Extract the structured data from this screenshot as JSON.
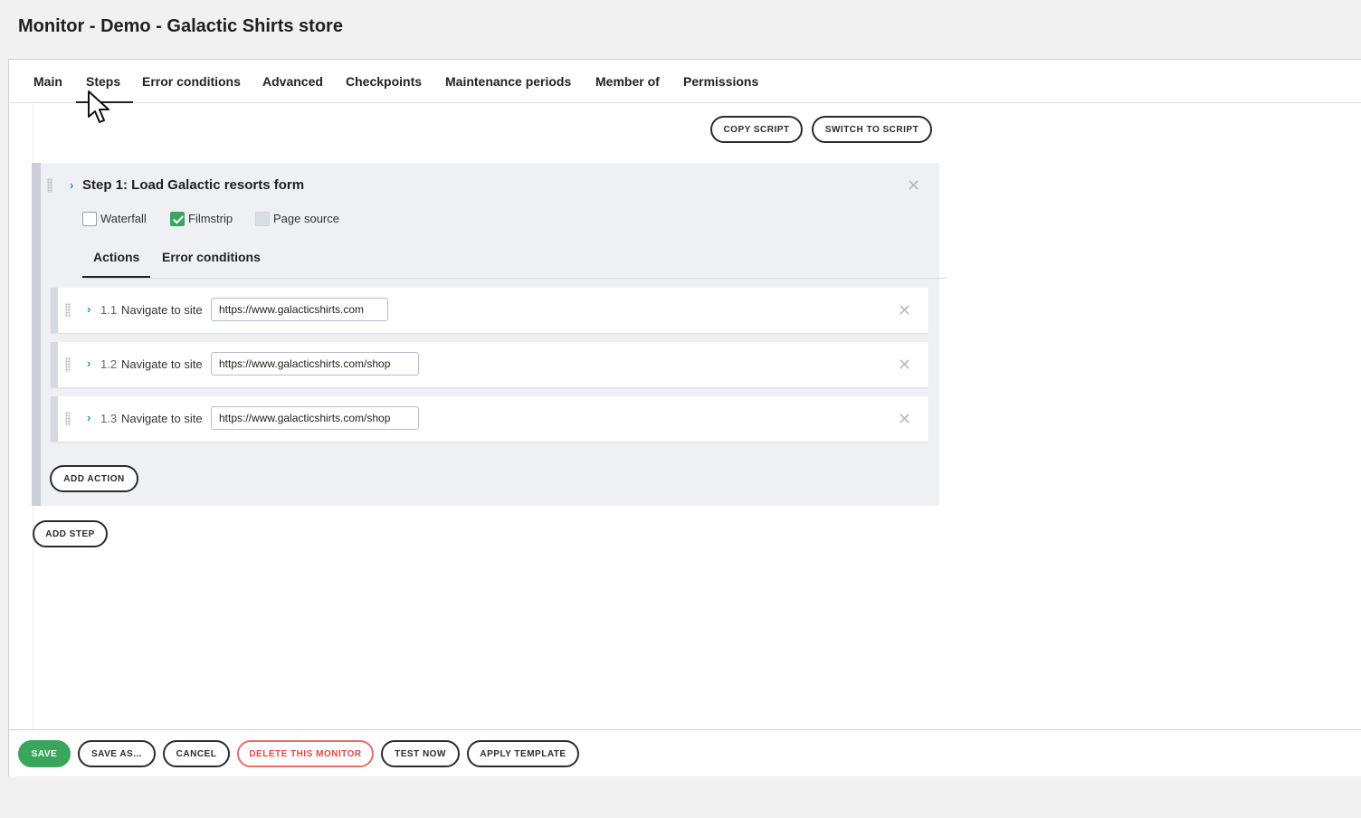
{
  "page": {
    "title": "Monitor - Demo - Galactic Shirts store"
  },
  "tabs": [
    {
      "label": "Main"
    },
    {
      "label": "Steps"
    },
    {
      "label": "Error conditions"
    },
    {
      "label": "Advanced"
    },
    {
      "label": "Checkpoints"
    },
    {
      "label": "Maintenance periods"
    },
    {
      "label": "Member of"
    },
    {
      "label": "Permissions"
    }
  ],
  "active_tab": "Steps",
  "toolbar": {
    "copy_script": "COPY SCRIPT",
    "switch_to_script": "SWITCH TO SCRIPT"
  },
  "step": {
    "title": "Step 1: Load Galactic resorts form",
    "options": [
      {
        "label": "Waterfall",
        "checked": false
      },
      {
        "label": "Filmstrip",
        "checked": true
      },
      {
        "label": "Page source",
        "checked": false,
        "disabled": true
      }
    ],
    "tabs": [
      {
        "label": "Actions"
      },
      {
        "label": "Error conditions"
      }
    ],
    "actions": [
      {
        "number": "1.1",
        "label": "Navigate to site",
        "url": "https://www.galacticshirts.com"
      },
      {
        "number": "1.2",
        "label": "Navigate to site",
        "url": "https://www.galacticshirts.com/shop"
      },
      {
        "number": "1.3",
        "label": "Navigate to site",
        "url": "https://www.galacticshirts.com/shop"
      }
    ],
    "add_action": "ADD ACTION"
  },
  "add_step": "ADD STEP",
  "footer": {
    "save": "SAVE",
    "save_as": "SAVE AS...",
    "cancel": "CANCEL",
    "delete": "DELETE THIS MONITOR",
    "test_now": "TEST NOW",
    "apply_template": "APPLY TEMPLATE"
  },
  "colors": {
    "primary": "#3aa55d",
    "danger": "#d94a4a",
    "chevron": "#2a8fc7"
  }
}
